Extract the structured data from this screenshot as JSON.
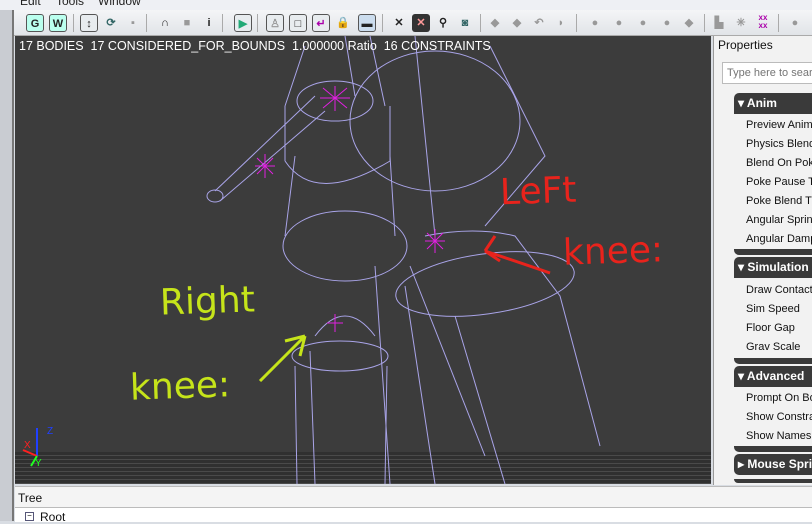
{
  "menu": [
    "Edit",
    "Tools",
    "Window"
  ],
  "toolbar": {
    "icons": [
      "ground-toggle",
      "wireframe-toggle",
      "move-tool",
      "rotate-tool",
      "scale-tool",
      "magnet",
      "record",
      "info",
      "play",
      "body-mode",
      "box-mode",
      "constraint-mode",
      "lock",
      "shape-bar",
      "skeleton",
      "skeleton-selected",
      "physics-asset",
      "material"
    ],
    "labels": {
      "g": "G",
      "w": "W",
      "info": "i"
    }
  },
  "viewport": {
    "stats": "17 BODIES  17 CONSIDERED_FOR_BOUNDS  1.000000 Ratio  16 CONSTRAINTS",
    "annotations": {
      "left_line1": "LeFt",
      "left_line2": "knee:",
      "right_line1": "Right",
      "right_line2": "knee:",
      "left_color": "#e8231c",
      "right_color": "#c6e41a"
    },
    "axes": {
      "x": "X",
      "y": "Y",
      "z": "Z"
    }
  },
  "properties": {
    "title": "Properties",
    "search_placeholder": "Type here to search",
    "sections": [
      {
        "name": "Anim",
        "expanded": true,
        "items": [
          "Preview Anim",
          "Physics Blend",
          "Blend On Poke",
          "Poke Pause Time",
          "Poke Blend Time",
          "Angular Spring",
          "Angular Damping"
        ]
      },
      {
        "name": "Simulation",
        "expanded": true,
        "items": [
          "Draw Contacts",
          "Sim Speed",
          "Floor Gap",
          "Grav Scale"
        ]
      },
      {
        "name": "Advanced",
        "expanded": true,
        "items": [
          "Prompt On Bone",
          "Show Constraints",
          "Show Names In"
        ]
      },
      {
        "name": "Mouse Spring",
        "expanded": false,
        "items": []
      }
    ]
  },
  "tree": {
    "title": "Tree",
    "root": "Root"
  }
}
